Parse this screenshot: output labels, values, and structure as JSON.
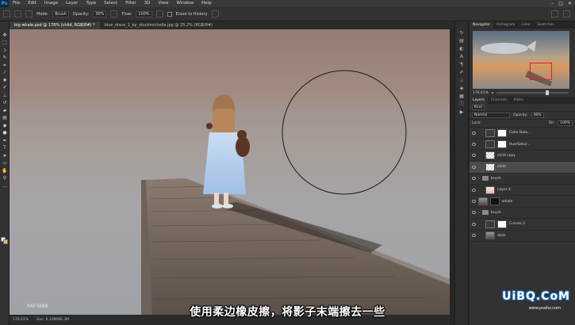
{
  "menubar": {
    "app": "Ps",
    "items": [
      "File",
      "Edit",
      "Image",
      "Layer",
      "Type",
      "Select",
      "Filter",
      "3D",
      "View",
      "Window",
      "Help"
    ]
  },
  "options": {
    "mode_label": "Mode:",
    "mode_value": "Brush",
    "opacity_label": "Opacity:",
    "opacity_value": "30%",
    "flow_label": "Flow:",
    "flow_value": "100%",
    "erase_history": "Erase to History"
  },
  "tabs": [
    {
      "label": "big whale.psd @ 176% (child, RGB/8#) *",
      "active": true
    },
    {
      "label": "blue_dress_1_by_stockmichelle.jpg @ 25.2% (RGB/8#)",
      "active": false
    }
  ],
  "canvas": {
    "credit": "RAFYA88"
  },
  "status": {
    "zoom": "176.61%",
    "doc": "Doc: 6.33M/86.3M"
  },
  "subtitle": "使用柔边橡皮擦，将影子末端擦去一些",
  "panels": {
    "top_tabs": [
      "Navigator",
      "Histogram",
      "Color",
      "Swatches"
    ],
    "zoom": "176.61%",
    "layer_tabs": [
      "Layers",
      "Channels",
      "Paths"
    ],
    "filter_kind": "Kind",
    "blend_mode": "Normal",
    "opacity_label": "Opacity:",
    "opacity_value": "46%",
    "lock_label": "Lock:",
    "fill_label": "Fill:",
    "fill_value": "100%",
    "layers": [
      {
        "name": "Color Bala...",
        "thumb": "white",
        "kind": "adj"
      },
      {
        "name": "Hue/Satur...",
        "thumb": "white",
        "kind": "adj"
      },
      {
        "name": "child copy",
        "thumb": "checker",
        "kind": "pixel"
      },
      {
        "name": "child",
        "thumb": "checker",
        "kind": "pixel",
        "selected": true
      },
      {
        "name": "brush",
        "thumb": "",
        "kind": "folder"
      },
      {
        "name": "Layer 4",
        "thumb": "orange",
        "kind": "pixel"
      },
      {
        "name": "whale",
        "thumb": "photo",
        "kind": "pixel"
      },
      {
        "name": "brush",
        "thumb": "",
        "kind": "folder"
      },
      {
        "name": "Curves 2",
        "thumb": "white",
        "kind": "adj"
      },
      {
        "name": "deck",
        "thumb": "photo",
        "kind": "pixel"
      }
    ]
  },
  "watermark": {
    "logo": "UiBQ.CoM",
    "url": "www.psahz.com"
  },
  "colors": {
    "accent": "#31a8ff",
    "navigator_box": "#e02020"
  }
}
